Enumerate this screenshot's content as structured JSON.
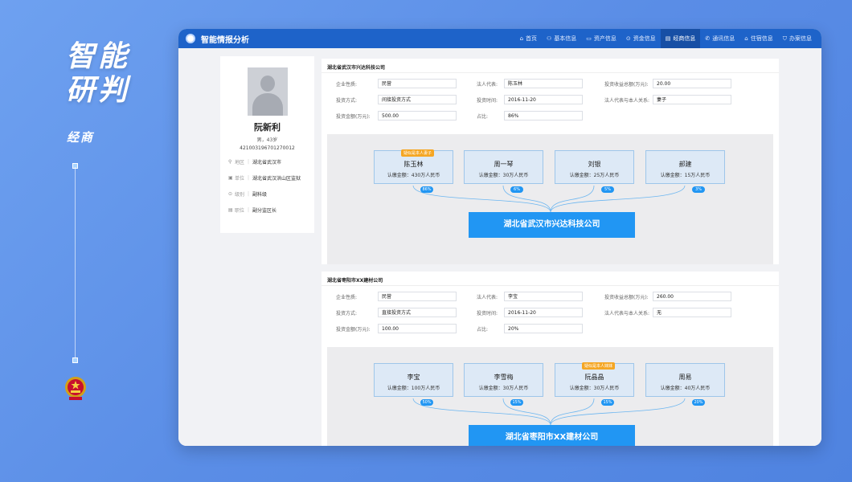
{
  "hero": {
    "title_line1": "智能",
    "title_line2": "研判",
    "subtitle": "经商"
  },
  "app": {
    "title": "智能情报分析",
    "nav": [
      {
        "label": "首页",
        "icon": "⌂"
      },
      {
        "label": "基本信息",
        "icon": "⚇"
      },
      {
        "label": "资产信息",
        "icon": "▭"
      },
      {
        "label": "资金信息",
        "icon": "⊙"
      },
      {
        "label": "经商信息",
        "icon": "▤",
        "active": true
      },
      {
        "label": "通讯信息",
        "icon": "✆"
      },
      {
        "label": "住宿信息",
        "icon": "⌂"
      },
      {
        "label": "办案信息",
        "icon": "⛉"
      }
    ]
  },
  "profile": {
    "name": "阮新利",
    "meta": "男，43岁",
    "id_number": "421003196701270012",
    "rows": [
      {
        "icon": "⚲",
        "label": "地区",
        "value": "湖北省武汉市"
      },
      {
        "icon": "▣",
        "label": "单位",
        "value": "湖北省武汉洪山区监狱"
      },
      {
        "icon": "⊙",
        "label": "级别",
        "value": "副科级"
      },
      {
        "icon": "▤",
        "label": "职位",
        "value": "副分监区长"
      }
    ]
  },
  "companies": [
    {
      "title": "湖北省武汉市兴达科技公司",
      "fields": {
        "nature_label": "企业性质:",
        "nature": "民营",
        "legal_label": "法人代表:",
        "legal": "陈玉林",
        "total_label": "投资收益总额(万元):",
        "total": "20.00",
        "method_label": "投资方式:",
        "method": "间接投资方式",
        "time_label": "投资时间:",
        "time": "2016-11-20",
        "relation_label": "法人代表与本人关系:",
        "relation": "妻子",
        "amount_label": "投资金额(万元):",
        "amount": "500.00",
        "ratio_label": "占比:",
        "ratio": "86%"
      },
      "shareholders": [
        {
          "name": "陈玉林",
          "capital": "认缴金额：430万人民币",
          "pct": "86%",
          "tag": "疑似是本人妻子"
        },
        {
          "name": "周一琴",
          "capital": "认缴金额：30万人民币",
          "pct": "6%",
          "tag": ""
        },
        {
          "name": "刘银",
          "capital": "认缴金额：25万人民币",
          "pct": "5%",
          "tag": ""
        },
        {
          "name": "郝建",
          "capital": "认缴金额：15万人民币",
          "pct": "3%",
          "tag": ""
        }
      ],
      "company_name": "湖北省武汉市兴达科技公司"
    },
    {
      "title": "湖北省枣阳市XX建材公司",
      "fields": {
        "nature_label": "企业性质:",
        "nature": "民营",
        "legal_label": "法人代表:",
        "legal": "李宝",
        "total_label": "投资收益总额(万元):",
        "total": "260.00",
        "method_label": "投资方式:",
        "method": "直接投资方式",
        "time_label": "投资时间:",
        "time": "2016-11-20",
        "relation_label": "法人代表与本人关系:",
        "relation": "无",
        "amount_label": "投资金额(万元):",
        "amount": "100.00",
        "ratio_label": "占比:",
        "ratio": "20%"
      },
      "shareholders": [
        {
          "name": "李宝",
          "capital": "认缴金额：100万人民币",
          "pct": "50%",
          "tag": ""
        },
        {
          "name": "李雪梅",
          "capital": "认缴金额：30万人民币",
          "pct": "15%",
          "tag": ""
        },
        {
          "name": "阮晶晶",
          "capital": "认缴金额：30万人民币",
          "pct": "15%",
          "tag": "疑似是本人妹妹"
        },
        {
          "name": "周易",
          "capital": "认缴金额：40万人民币",
          "pct": "20%",
          "tag": ""
        }
      ],
      "company_name": "湖北省枣阳市XX建材公司"
    }
  ],
  "colors": {
    "header": "#1e63c9",
    "accent": "#2196f3",
    "tag": "#f5a623"
  }
}
